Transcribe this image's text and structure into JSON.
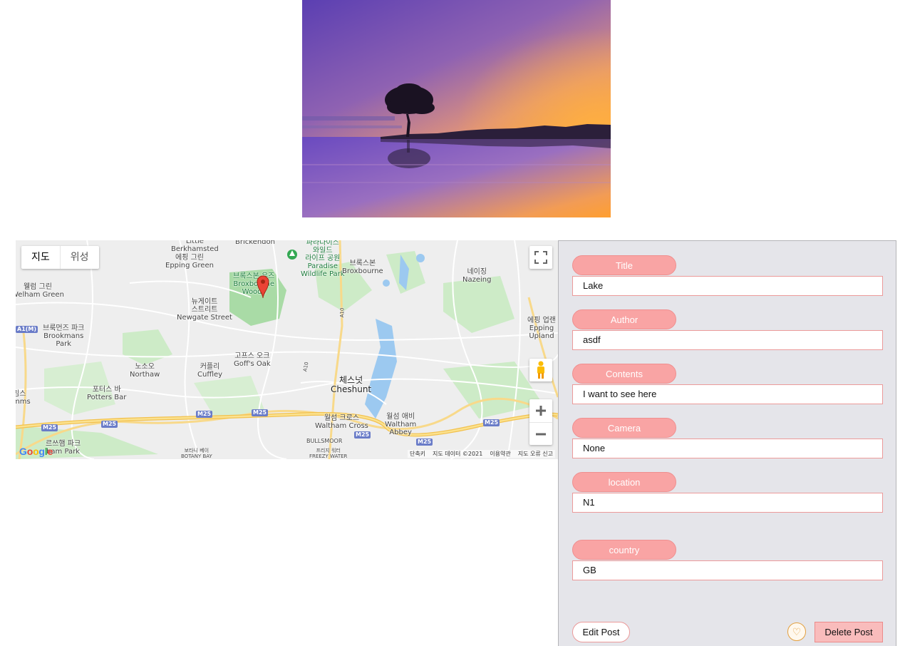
{
  "map": {
    "type_control": [
      "지도",
      "위성"
    ],
    "labels": [
      {
        "id": "little",
        "text": "Little\nBerkhamsted"
      },
      {
        "id": "brickendon",
        "text": "Brickendon"
      },
      {
        "id": "paradise",
        "text": "파라다이스\n와일드\n라이프 공원\nParadise\nWildlife Park"
      },
      {
        "id": "broxbourne",
        "text": "브록스본\nBroxbourne"
      },
      {
        "id": "epping-green",
        "text": "에핑 그린\nEpping Green"
      },
      {
        "id": "broxbourne-woods",
        "text": "브록스본 우즈\nBroxbourne\nWoods"
      },
      {
        "id": "nazeing",
        "text": "네이징\nNazeing"
      },
      {
        "id": "welham",
        "text": "웰럼 그린\nWelham Green"
      },
      {
        "id": "newgate",
        "text": "뉴게이트\n스트리트\nNewgate Street"
      },
      {
        "id": "brookmans",
        "text": "브룩먼즈 파크\nBrookmans\nPark"
      },
      {
        "id": "epping-upland",
        "text": "에핑 업랜\nEpping\nUpland"
      },
      {
        "id": "goffs",
        "text": "고프스 오크\nGoff's Oak"
      },
      {
        "id": "northaw",
        "text": "노소오\nNorthaw"
      },
      {
        "id": "cuffley",
        "text": "커플리\nCuffley"
      },
      {
        "id": "cheshunt",
        "text": "체스넛\nCheshunt"
      },
      {
        "id": "potters",
        "text": "포터스 바\nPotters Bar"
      },
      {
        "id": "mimms",
        "text": "밈스\nmms"
      },
      {
        "id": "waltham-cross",
        "text": "월섬 크로스\nWaltham Cross"
      },
      {
        "id": "waltham-abbey",
        "text": "월섬 애비\nWaltham\nAbbey"
      },
      {
        "id": "bullsmoor",
        "text": "BULLSMOOR"
      },
      {
        "id": "crews",
        "text": "르쓰햄 파크\nham Park"
      },
      {
        "id": "botany",
        "text": "보타니 베이\nBOTANY BAY"
      },
      {
        "id": "freezy",
        "text": "프리지 워터\nFREEZY WATER"
      }
    ],
    "road_badges": [
      "A1(M)",
      "M25",
      "M25",
      "M25",
      "M25",
      "M25",
      "M25",
      "M25",
      "A10",
      "A10"
    ],
    "footer": [
      "단축키",
      "지도 데이터 ©2021",
      "이용약관",
      "지도 오류 신고"
    ],
    "logo": "Google"
  },
  "post": {
    "fields": [
      {
        "label": "Title",
        "value": "Lake"
      },
      {
        "label": "Author",
        "value": "asdf"
      },
      {
        "label": "Contents",
        "value": "I want to see here"
      },
      {
        "label": "Camera",
        "value": "None"
      },
      {
        "label": "location",
        "value": "N1"
      },
      {
        "label": "country",
        "value": "GB"
      }
    ],
    "edit_label": "Edit Post",
    "like_symbol": "♡",
    "delete_label": "Delete Post"
  },
  "colors": {
    "label_pink": "#f9a4a4",
    "panel_bg": "#e5e5ea",
    "delete_bg": "#f9bcbc"
  }
}
